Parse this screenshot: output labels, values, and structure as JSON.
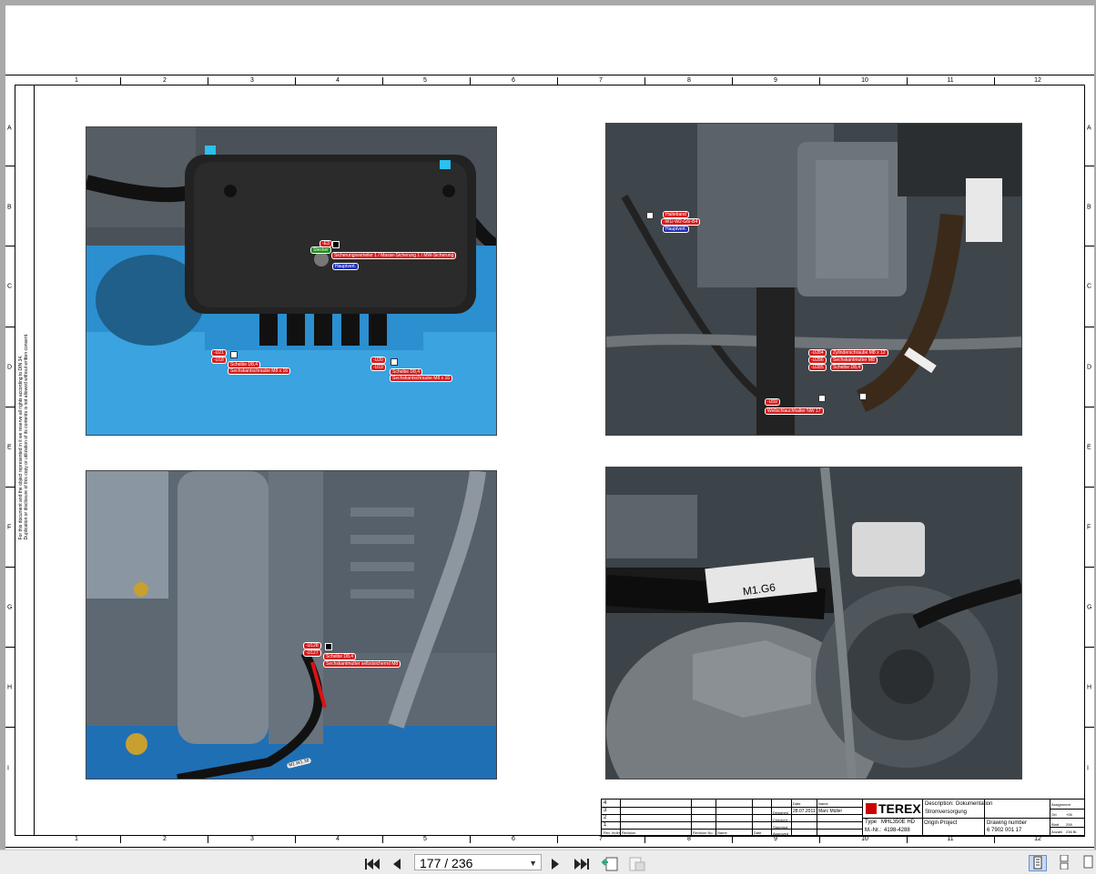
{
  "viewer": {
    "page_current": "177",
    "page_total": "236",
    "page_display": "177 / 236"
  },
  "rulers": {
    "columns": [
      "1",
      "2",
      "3",
      "4",
      "5",
      "6",
      "7",
      "8",
      "9",
      "10",
      "11",
      "12"
    ],
    "rows": [
      "A",
      "B",
      "C",
      "D",
      "E",
      "F",
      "G",
      "H",
      "I"
    ]
  },
  "copyright": {
    "line1": "For this document and the object represented in it we reserve all rights according to DIN 34.",
    "line2": "Duplication or disclosure of this copy or utilization of its contents is not allowed without written consent."
  },
  "photo1": {
    "tags": [
      "-E3",
      "Stecker",
      "Sicherungsverteiler 1 / Masse-Sicherung 1 / MW-Sicherung",
      "Hauptvert.",
      "-U21",
      "-U18",
      "Scheibe D8,4",
      "Sechskantschraube M8 x 16",
      "-U20",
      "-U19",
      "Scheibe D8,4",
      "Sechskantschraube M8 x 16"
    ]
  },
  "photo2": {
    "tags": [
      "Halteband",
      "-W1/-W2-G6/-B4",
      "Hauptvert.",
      "-U284",
      "-U286",
      "-U285",
      "Zylinderschraube M8 x 12",
      "Sechskantmutter M8",
      "Scheibe D8,4",
      "-U59",
      "Wellschlauchhalter NW 17"
    ]
  },
  "photo3": {
    "tags": [
      "-U128",
      "-U127",
      "Scheibe D8,4",
      "Sechskantmutter selbstsichernd M8"
    ],
    "cable_label": "M1.W1.38"
  },
  "photo4": {
    "cable_label": "M1.G6"
  },
  "titleblock": {
    "rev_rows": [
      "4",
      "3",
      "2",
      "1",
      "0"
    ],
    "rev_headers": [
      "Rev. Index",
      "Revision",
      "Revision No.",
      "Name",
      "Date"
    ],
    "date_label": "Date",
    "name_label": "Name",
    "designed_label": "Designed",
    "designed_date": "28.07.2011",
    "designed_name": "Marc Müller",
    "checked_label": "Checked",
    "standard_label": "Standard",
    "approved_label": "Approved",
    "logo": "TEREX",
    "description_label": "Description:",
    "description_value": "Dokumentation",
    "description_value2": "Stromversorgung",
    "type_label": "Type",
    "type_value": "MHL350E HD",
    "mnr_label": "M.-Nr.:",
    "mnr_value": "4198-4288",
    "origin_label": "Origin Project",
    "drawing_number_label": "Drawing number",
    "drawing_number_value": "6 7902 001 17",
    "assignment_label": "Assignment",
    "ort_label": "Ort",
    "ort_value": "+05",
    "blatt_label": "Blatt",
    "blatt_value": "258",
    "anzahl_label": "Anzahl",
    "anzahl_value": "236 Bl."
  },
  "colors": {
    "photo_bg": "#3f464c",
    "blue_part": "#2b8fd0",
    "tag_red": "#d21e1e"
  }
}
